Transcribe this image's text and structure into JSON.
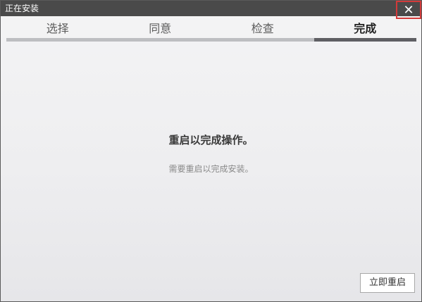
{
  "window": {
    "title": "正在安装",
    "close_glyph": "✕"
  },
  "steps": [
    {
      "label": "选择",
      "active": false
    },
    {
      "label": "同意",
      "active": false
    },
    {
      "label": "检查",
      "active": false
    },
    {
      "label": "完成",
      "active": true
    }
  ],
  "content": {
    "title": "重启以完成操作。",
    "subtitle": "需要重启以完成安装。"
  },
  "buttons": {
    "restart_label": "立即重启"
  },
  "colors": {
    "titlebar": "#4a4a4a",
    "close_highlight": "#d23a3a",
    "active_step_bar": "#5f5f63",
    "inactive_step_bar": "#bdbec1"
  }
}
